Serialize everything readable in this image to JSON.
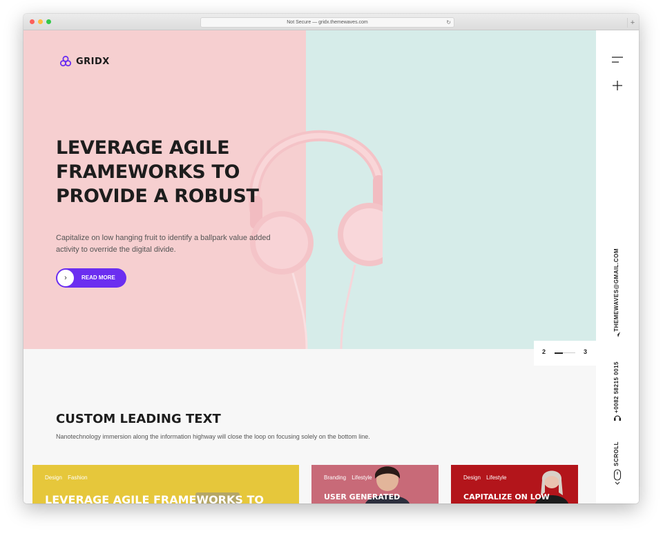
{
  "browser": {
    "url": "Not Secure — gridx.themewaves.com",
    "reload_icon": "↻",
    "new_tab_icon": "+"
  },
  "logo": {
    "text": "GRIDX"
  },
  "hero": {
    "title": "LEVERAGE AGILE FRAMEWORKS TO PROVIDE A ROBUST",
    "text": "Capitalize on low hanging fruit to identify a ballpark value added activity to override the digital divide.",
    "button_label": "READ MORE",
    "button_icon": "›",
    "prev_icon": "‹",
    "next_icon": "›",
    "slide_current": "2",
    "slide_next": "3",
    "colors": {
      "left": "#f6cfd0",
      "right": "#d6ece9",
      "accent": "#6b2ef0"
    }
  },
  "sidebar": {
    "email": "THEMEWAVES@GMAIL.COM",
    "phone": "+0082 58215 0015",
    "scroll": "SCROLL"
  },
  "section": {
    "title": "CUSTOM LEADING TEXT",
    "text": "Nanotechnology immersion along the information highway will close the loop on focusing solely on the bottom line."
  },
  "cards": [
    {
      "tags": "Design Fashion",
      "title": "LEVERAGE AGILE FRAMEWORKS TO PROVIDE A ROBUST SYNOPSIS",
      "color": "#e6c73b"
    },
    {
      "tags": "Branding Lifestyle",
      "title": "USER GENERATED CONTENT IN REAL-TIME",
      "color": "#c86a78"
    },
    {
      "tags": "Design Lifestyle",
      "title": "CAPITALIZE ON LOW HANGING FRUIT TO",
      "color": "#b3151b"
    }
  ]
}
